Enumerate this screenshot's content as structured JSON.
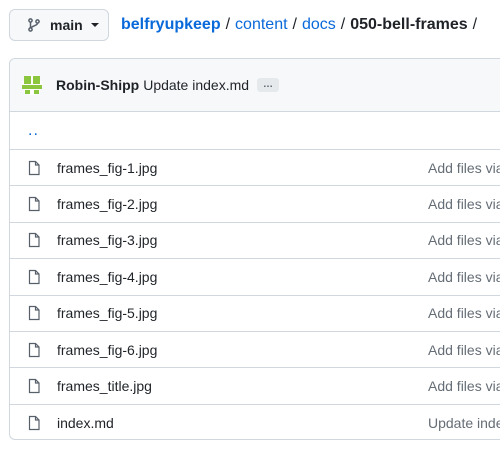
{
  "branch": {
    "name": "main",
    "icon": "git-branch-icon"
  },
  "breadcrumb": {
    "repo": "belfryupkeep",
    "segments": [
      "content",
      "docs"
    ],
    "separator": "/",
    "current": "050-bell-frames",
    "trailing_separator": "/"
  },
  "latest_commit": {
    "author": "Robin-Shipp",
    "message": "Update index.md",
    "ellipsis": "…"
  },
  "parent_link": "..",
  "files": [
    {
      "name": "frames_fig-1.jpg",
      "commit": "Add files via"
    },
    {
      "name": "frames_fig-2.jpg",
      "commit": "Add files via"
    },
    {
      "name": "frames_fig-3.jpg",
      "commit": "Add files via"
    },
    {
      "name": "frames_fig-4.jpg",
      "commit": "Add files via"
    },
    {
      "name": "frames_fig-5.jpg",
      "commit": "Add files via"
    },
    {
      "name": "frames_fig-6.jpg",
      "commit": "Add files via"
    },
    {
      "name": "frames_title.jpg",
      "commit": "Add files via"
    },
    {
      "name": "index.md",
      "commit": "Update inde"
    }
  ],
  "colors": {
    "link": "#0969da",
    "border": "#d0d7de",
    "muted": "#656d76",
    "avatar": "#8cc63f"
  }
}
